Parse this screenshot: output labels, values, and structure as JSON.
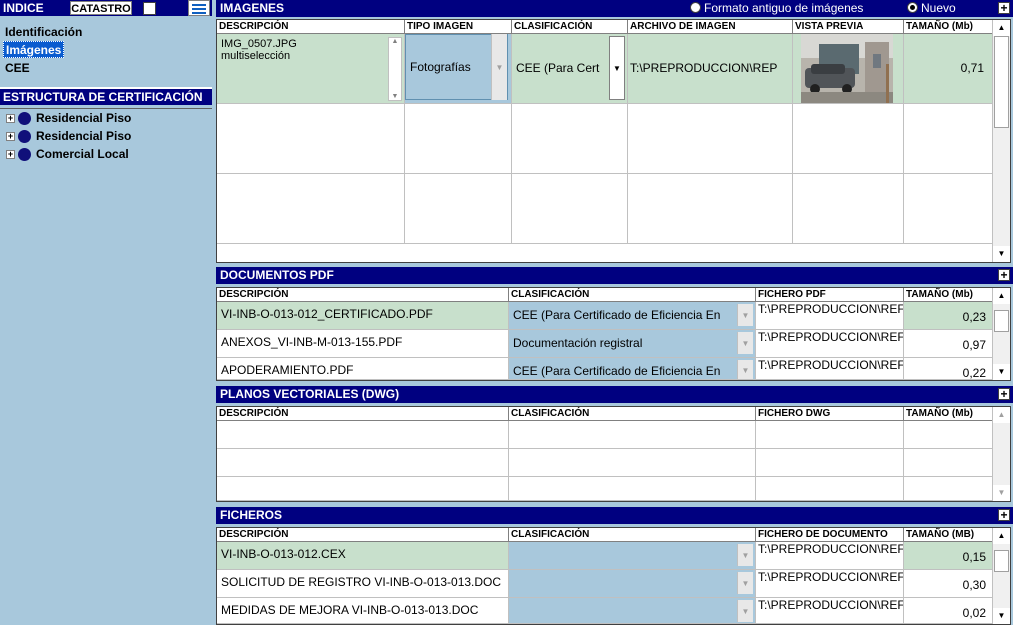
{
  "sidebar": {
    "header": "INDICE",
    "catastro_label": "CATASTRO",
    "nav_items": [
      "Identificación",
      "Imágenes",
      "CEE"
    ],
    "selected_index": 1,
    "structure_header": "ESTRUCTURA DE CERTIFICACIÓN",
    "tree_items": [
      "Residencial Piso",
      "Residencial Piso",
      "Comercial Local"
    ]
  },
  "imagenes": {
    "title": "IMAGENES",
    "radio_old": "Formato antiguo de imágenes",
    "radio_new": "Nuevo",
    "selected_radio": "Nuevo",
    "columns": [
      "DESCRIPCIÓN",
      "TIPO IMAGEN",
      "CLASIFICACIÓN",
      "ARCHIVO DE IMAGEN",
      "VISTA PREVIA",
      "TAMAÑO (Mb)"
    ],
    "rows": [
      {
        "desc_line1": "IMG_0507.JPG",
        "desc_line2": "multiselección",
        "tipo": "Fotografías",
        "clasificacion": "CEE (Para Cert",
        "archivo": "T:\\PREPRODUCCION\\REP",
        "tamano": "0,71"
      }
    ]
  },
  "pdf": {
    "title": "DOCUMENTOS PDF",
    "columns": [
      "DESCRIPCIÓN",
      "CLASIFICACIÓN",
      "FICHERO PDF",
      "TAMAÑO (Mb)"
    ],
    "rows": [
      {
        "desc": "VI-INB-O-013-012_CERTIFICADO.PDF",
        "clasificacion": "CEE (Para Certificado de Eficiencia En",
        "fichero": "T:\\PREPRODUCCION\\REF",
        "tamano": "0,23"
      },
      {
        "desc": "ANEXOS_VI-INB-M-013-155.PDF",
        "clasificacion": "Documentación registral",
        "fichero": "T:\\PREPRODUCCION\\REF",
        "tamano": "0,97"
      },
      {
        "desc": "APODERAMIENTO.PDF",
        "clasificacion": "CEE (Para Certificado de Eficiencia En",
        "fichero": "T:\\PREPRODUCCION\\REF",
        "tamano": "0,22"
      }
    ]
  },
  "dwg": {
    "title": "PLANOS VECTORIALES (DWG)",
    "columns": [
      "DESCRIPCIÓN",
      "CLASIFICACIÓN",
      "FICHERO DWG",
      "TAMAÑO (Mb)"
    ]
  },
  "ficheros": {
    "title": "FICHEROS",
    "columns": [
      "DESCRIPCIÓN",
      "CLASIFICACIÓN",
      "FICHERO DE DOCUMENTO",
      "TAMAÑO (MB)"
    ],
    "rows": [
      {
        "desc": "VI-INB-O-013-012.CEX",
        "fichero": "T:\\PREPRODUCCION\\REF",
        "tamano": "0,15"
      },
      {
        "desc": "SOLICITUD DE REGISTRO VI-INB-O-013-013.DOC",
        "fichero": "T:\\PREPRODUCCION\\REF",
        "tamano": "0,30"
      },
      {
        "desc": "MEDIDAS DE MEJORA VI-INB-O-013-013.DOC",
        "fichero": "T:\\PREPRODUCCION\\REF",
        "tamano": "0,02"
      }
    ]
  },
  "icons": {
    "plus": "+",
    "expand": "+",
    "arrow_down": "▼",
    "arrow_up": "▲"
  }
}
